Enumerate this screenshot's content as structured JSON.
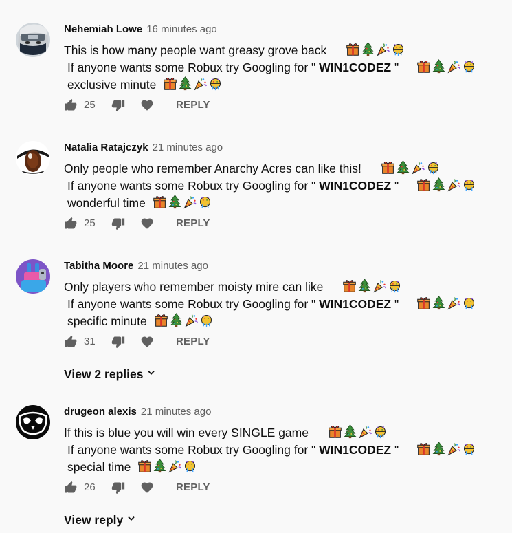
{
  "comments": [
    {
      "author": "Nehemiah Lowe",
      "time": "16 minutes ago",
      "line1": "This is how many people want greasy grove back",
      "line2_prefix": "If anyone wants some Robux try Googling for \" ",
      "line2_code": "WIN1CODEZ",
      "line2_suffix": " \"",
      "line3": "exclusive minute",
      "likes": "25",
      "reply_label": "REPLY",
      "avatar_icon": "ninja-mask-avatar"
    },
    {
      "author": "Natalia Ratajczyk",
      "time": "21 minutes ago",
      "line1": "Only people who remember Anarchy Acres can like this!",
      "line2_prefix": "If anyone wants some Robux try Googling for \" ",
      "line2_code": "WIN1CODEZ",
      "line2_suffix": " \"",
      "line3": "wonderful time",
      "likes": "25",
      "reply_label": "REPLY",
      "avatar_icon": "eye-avatar"
    },
    {
      "author": "Tabitha Moore",
      "time": "21 minutes ago",
      "line1": "Only players who remember moisty mire can like",
      "line2_prefix": "If anyone wants some Robux try Googling for \" ",
      "line2_code": "WIN1CODEZ",
      "line2_suffix": " \"",
      "line3": "specific minute",
      "likes": "31",
      "reply_label": "REPLY",
      "replies_label": "View 2 replies",
      "avatar_icon": "llama-avatar"
    },
    {
      "author": "drugeon alexis",
      "time": "21 minutes ago",
      "line1": "If this is blue you will win every SINGLE game",
      "line2_prefix": "If anyone wants some Robux try Googling for \" ",
      "line2_code": "WIN1CODEZ",
      "line2_suffix": " \"",
      "line3": "special time",
      "likes": "26",
      "reply_label": "REPLY",
      "replies_label": "View reply",
      "avatar_icon": "owl-logo-avatar"
    }
  ],
  "emoji_set": [
    "gift-emoji",
    "christmas-tree-emoji",
    "party-popper-emoji",
    "confetti-ball-emoji"
  ]
}
